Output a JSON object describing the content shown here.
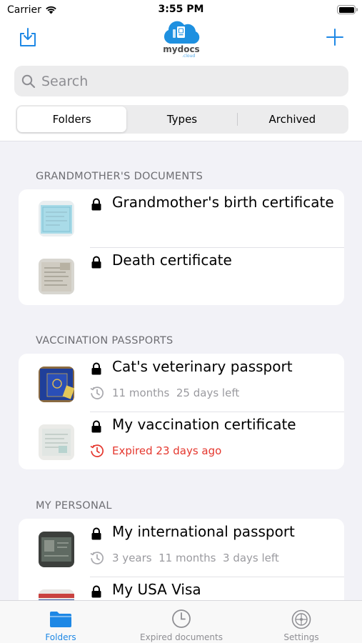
{
  "status_bar": {
    "carrier": "Carrier",
    "time": "3:55 PM"
  },
  "header": {
    "brand": "mydocs",
    "brand_sub": ".cloud"
  },
  "search": {
    "placeholder": "Search"
  },
  "segments": [
    {
      "label": "Folders",
      "active": true
    },
    {
      "label": "Types",
      "active": false
    },
    {
      "label": "Archived",
      "active": false
    }
  ],
  "sections": [
    {
      "title": "GRANDMOTHER'S DOCUMENTS",
      "items": [
        {
          "title": "Grandmother's birth certificate"
        },
        {
          "title": "Death certificate"
        }
      ]
    },
    {
      "title": "VACCINATION PASSPORTS",
      "items": [
        {
          "title": "Cat's veterinary passport",
          "subtitle": "11 months  25 days left"
        },
        {
          "title": "My vaccination certificate",
          "subtitle": "Expired 23 days ago"
        }
      ]
    },
    {
      "title": "MY PERSONAL",
      "items": [
        {
          "title": "My international passport",
          "subtitle": "3 years  11 months  3 days left"
        },
        {
          "title": "My USA Visa"
        }
      ]
    }
  ],
  "tab_bar": [
    {
      "label": "Folders",
      "icon": "folder-icon",
      "active": true
    },
    {
      "label": "Expired documents",
      "icon": "clock-icon",
      "active": false
    },
    {
      "label": "Settings",
      "icon": "settings-icon",
      "active": false
    }
  ],
  "colors": {
    "accent": "#1e88e5",
    "expired": "#e5372e",
    "secondary": "#9a9a9f"
  }
}
